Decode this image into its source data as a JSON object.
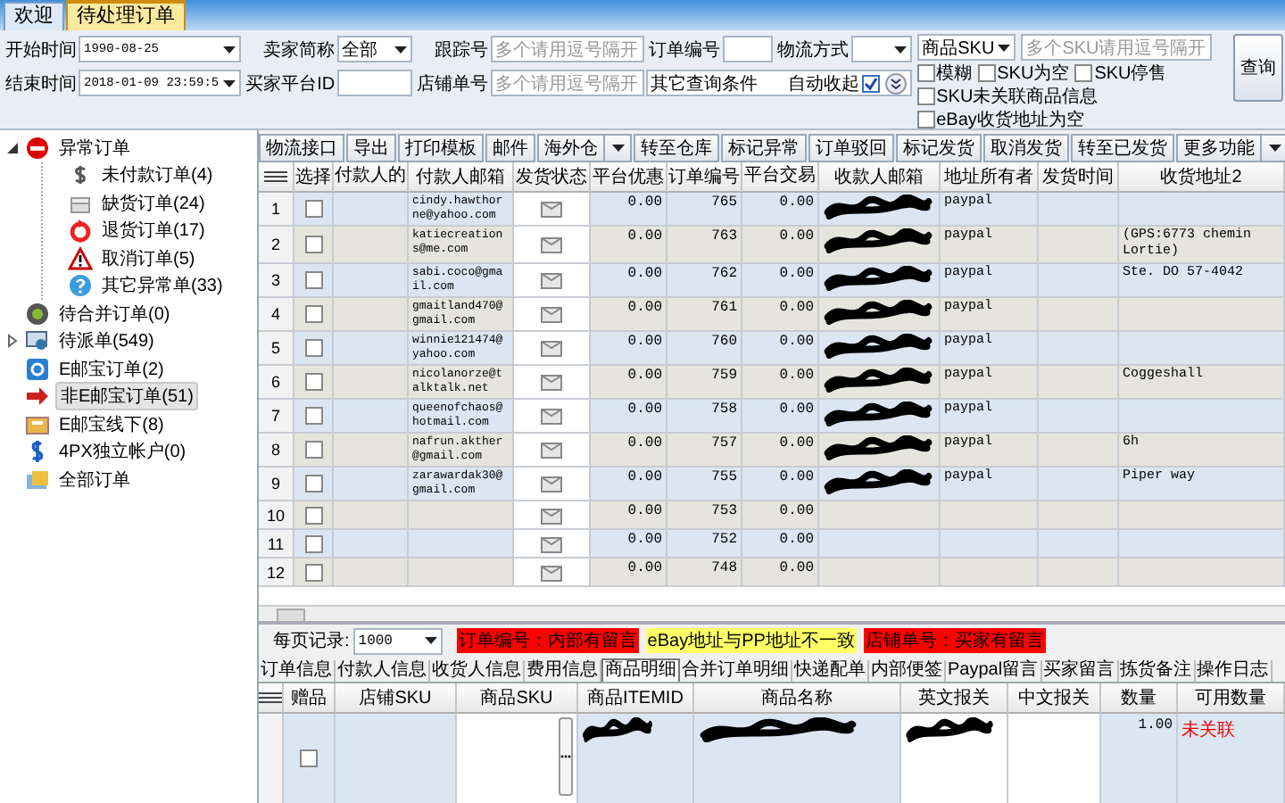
{
  "tabs": [
    {
      "label": "欢迎",
      "selected": false
    },
    {
      "label": "待处理订单",
      "selected": true
    }
  ],
  "filters": {
    "start_time": {
      "label": "开始时间",
      "value": "1990-08-25"
    },
    "end_time": {
      "label": "结束时间",
      "value": "2018-01-09 23:59:5"
    },
    "seller": {
      "label": "卖家简称",
      "value": "全部"
    },
    "buyer_id": {
      "label": "买家平台ID"
    },
    "tracking_no": {
      "label": "跟踪号",
      "placeholder": "多个请用逗号隔开"
    },
    "store_order_no": {
      "label": "店铺单号",
      "placeholder": "多个请用逗号隔开"
    },
    "order_no": {
      "label": "订单编号"
    },
    "shipping": {
      "label": "物流方式"
    },
    "other": {
      "value": "其它查询条件",
      "auto_collapse_label": "自动收起",
      "auto_collapse": true
    },
    "sku_type": {
      "value": "商品SKU"
    },
    "sku_field": {
      "placeholder": "多个SKU请用逗号隔开"
    },
    "fuzzy": {
      "label": "模糊",
      "checked": false
    },
    "options": [
      {
        "label": "SKU为空",
        "checked": false
      },
      {
        "label": "SKU停售",
        "checked": false
      },
      {
        "label": "SKU未关联商品信息",
        "checked": false
      },
      {
        "label": "eBay收货地址为空",
        "checked": false
      }
    ],
    "query_button": "查询"
  },
  "tree": [
    {
      "label": "异常订单",
      "expanded": true,
      "selected": false,
      "children": [
        {
          "label": "未付款订单(4)",
          "selected": false
        },
        {
          "label": "缺货订单(24)",
          "selected": false
        },
        {
          "label": "退货订单(17)",
          "selected": false
        },
        {
          "label": "取消订单(5)",
          "selected": false
        },
        {
          "label": "其它异常单(33)",
          "selected": false
        }
      ]
    },
    {
      "label": "待合并订单(0)",
      "selected": false
    },
    {
      "label": "待派单(549)",
      "expanded": false,
      "selected": false
    },
    {
      "label": "E邮宝订单(2)",
      "selected": false
    },
    {
      "label": "非E邮宝订单(51)",
      "selected": true
    },
    {
      "label": "E邮宝线下(8)",
      "selected": false
    },
    {
      "label": "4PX独立帐户(0)",
      "selected": false
    },
    {
      "label": "全部订单",
      "selected": false
    }
  ],
  "toolbar": [
    {
      "label": "物流接口",
      "dropdown": false
    },
    {
      "label": "导出",
      "dropdown": false
    },
    {
      "label": "打印模板",
      "dropdown": false
    },
    {
      "label": "邮件",
      "dropdown": false
    },
    {
      "label": "海外仓",
      "dropdown": true
    },
    {
      "label": "转至仓库",
      "dropdown": false
    },
    {
      "label": "标记异常",
      "dropdown": false
    },
    {
      "label": "订单驳回",
      "dropdown": false
    },
    {
      "label": "标记发货",
      "dropdown": false
    },
    {
      "label": "取消发货",
      "dropdown": false
    },
    {
      "label": "转至已发货",
      "dropdown": false
    },
    {
      "label": "更多功能",
      "dropdown": true
    }
  ],
  "table": {
    "columns": [
      "选择",
      "付款人的",
      "付款人邮箱",
      "发货状态",
      "平台优惠",
      "订单编号",
      "平台交易",
      "收款人邮箱",
      "地址所有者",
      "发货时间",
      "收货地址2"
    ],
    "rows": [
      {
        "number": "1",
        "checked": false,
        "payer_email": "cindy.hawthorne@yahoo.com",
        "discount": "0.00",
        "order_no": "765",
        "trade": "0.00",
        "receiver_redacted": true,
        "owner": "paypal"
      },
      {
        "number": "2",
        "checked": false,
        "payer_email": "katiecreations@me.com",
        "discount": "0.00",
        "order_no": "763",
        "trade": "0.00",
        "receiver_redacted": true,
        "owner": "paypal",
        "address2": "(GPS:6773 chemin Lortie)"
      },
      {
        "number": "3",
        "checked": false,
        "payer_email": "sabi.coco@gmail.com",
        "discount": "0.00",
        "order_no": "762",
        "trade": "0.00",
        "receiver_redacted": true,
        "owner": "paypal",
        "address2": "Ste. DO 57-4042"
      },
      {
        "number": "4",
        "checked": false,
        "payer_email": "gmaitland470@gmail.com",
        "discount": "0.00",
        "order_no": "761",
        "trade": "0.00",
        "receiver_redacted": true,
        "owner": "paypal"
      },
      {
        "number": "5",
        "checked": false,
        "payer_email": "winnie121474@yahoo.com",
        "discount": "0.00",
        "order_no": "760",
        "trade": "0.00",
        "receiver_redacted": true,
        "owner": "paypal"
      },
      {
        "number": "6",
        "checked": false,
        "payer_email": "nicolanorze@talktalk.net",
        "discount": "0.00",
        "order_no": "759",
        "trade": "0.00",
        "receiver_redacted": true,
        "owner": "paypal",
        "address2": "Coggeshall"
      },
      {
        "number": "7",
        "checked": false,
        "payer_email": "queenofchaos@hotmail.com",
        "discount": "0.00",
        "order_no": "758",
        "trade": "0.00",
        "receiver_redacted": true,
        "owner": "paypal"
      },
      {
        "number": "8",
        "checked": false,
        "payer_email": "nafrun.akther@gmail.com",
        "discount": "0.00",
        "order_no": "757",
        "trade": "0.00",
        "receiver_redacted": true,
        "owner": "paypal",
        "address2": "6h"
      },
      {
        "number": "9",
        "checked": false,
        "payer_email": "zarawardak30@gmail.com",
        "discount": "0.00",
        "order_no": "755",
        "trade": "0.00",
        "receiver_redacted": true,
        "owner": "paypal",
        "address2": "Piper way"
      },
      {
        "number": "10",
        "checked": false,
        "discount": "0.00",
        "order_no": "753",
        "trade": "0.00",
        "receiver_redacted": false
      },
      {
        "number": "11",
        "checked": false,
        "discount": "0.00",
        "order_no": "752",
        "trade": "0.00",
        "receiver_redacted": false
      },
      {
        "number": "12",
        "checked": false,
        "discount": "0.00",
        "order_no": "748",
        "trade": "0.00",
        "receiver_redacted": false
      }
    ]
  },
  "page_size": {
    "label": "每页记录:",
    "value": "1000"
  },
  "legend": [
    {
      "label": "订单编号：内部有留言",
      "color": "#ff0000"
    },
    {
      "label": "eBay地址与PP地址不一致",
      "color": "#ffff66"
    },
    {
      "label": "店铺单号：买家有留言",
      "color": "#ff0000"
    }
  ],
  "detail_tabs": [
    {
      "label": "订单信息",
      "selected": false
    },
    {
      "label": "付款人信息",
      "selected": false
    },
    {
      "label": "收货人信息",
      "selected": false
    },
    {
      "label": "费用信息",
      "selected": false
    },
    {
      "label": "商品明细",
      "selected": true
    },
    {
      "label": "合并订单明细",
      "selected": false
    },
    {
      "label": "快递配单",
      "selected": false
    },
    {
      "label": "内部便签",
      "selected": false
    },
    {
      "label": "Paypal留言",
      "selected": false
    },
    {
      "label": "买家留言",
      "selected": false
    },
    {
      "label": "拣货备注",
      "selected": false
    },
    {
      "label": "操作日志",
      "selected": false
    }
  ],
  "detail_table": {
    "columns": [
      "赠品",
      "店铺SKU",
      "商品SKU",
      "商品ITEMID",
      "商品名称",
      "英文报关",
      "中文报关",
      "数量",
      "可用数量"
    ],
    "rows": [
      {
        "gift": false,
        "itemid_redacted": true,
        "name_redacted": true,
        "en_redacted": true,
        "quantity": "1.00",
        "available": "未关联"
      }
    ]
  }
}
